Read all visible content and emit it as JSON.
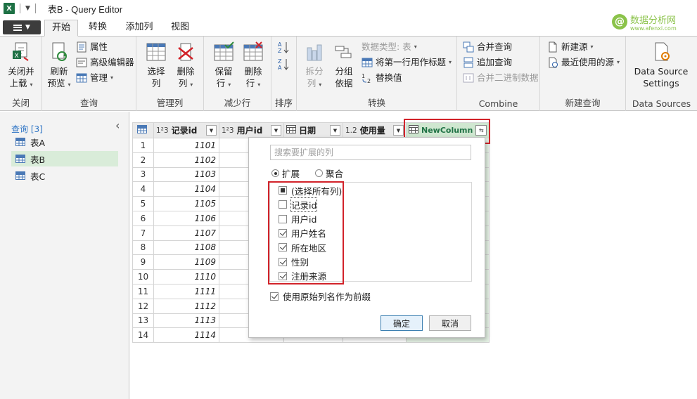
{
  "window": {
    "app_icon": "X",
    "title": "表B - Query Editor"
  },
  "tabs": [
    {
      "label": "开始",
      "active": true
    },
    {
      "label": "转换",
      "active": false
    },
    {
      "label": "添加列",
      "active": false
    },
    {
      "label": "视图",
      "active": false
    }
  ],
  "ribbon": {
    "close_group": {
      "label": "关闭",
      "close_load_line1": "关闭并",
      "close_load_line2": "上载"
    },
    "query_group": {
      "label": "查询",
      "refresh_line1": "刷新",
      "refresh_line2": "预览",
      "properties": "属性",
      "advanced_editor": "高级编辑器",
      "manage": "管理"
    },
    "manage_cols_group": {
      "label": "管理列",
      "choose_line1": "选择",
      "choose_line2": "列",
      "remove_line1": "删除",
      "remove_line2": "列"
    },
    "reduce_rows_group": {
      "label": "减少行",
      "keep_line1": "保留",
      "keep_line2": "行",
      "remove_line1": "删除",
      "remove_line2": "行"
    },
    "sort_group": {
      "label": "排序"
    },
    "transform_group": {
      "label": "转换",
      "split_line1": "拆分",
      "split_line2": "列",
      "group_line1": "分组",
      "group_line2": "依据",
      "data_type": "数据类型: 表",
      "first_row_header": "将第一行用作标题",
      "replace_values": "替换值"
    },
    "combine_group": {
      "label": "Combine",
      "merge_queries": "合并查询",
      "append_queries": "追加查询",
      "combine_binaries": "合并二进制数据"
    },
    "new_query_group": {
      "label": "新建查询",
      "new_source": "新建源",
      "recent_sources": "最近使用的源"
    },
    "data_sources_group": {
      "label": "Data Sources",
      "settings_line1": "Data Source",
      "settings_line2": "Settings"
    }
  },
  "queries_pane": {
    "header": "查询 [3]",
    "items": [
      {
        "label": "表A",
        "selected": false
      },
      {
        "label": "表B",
        "selected": true
      },
      {
        "label": "表C",
        "selected": false
      }
    ]
  },
  "grid": {
    "columns": [
      {
        "type": "1²3",
        "name": "记录id"
      },
      {
        "type": "1²3",
        "name": "用户id"
      },
      {
        "type": "date-icon",
        "name": "日期"
      },
      {
        "type": "1.2",
        "name": "使用量"
      },
      {
        "type": "table-icon",
        "name": "NewColumn"
      }
    ],
    "rows": [
      {
        "n": "1",
        "id": "1101"
      },
      {
        "n": "2",
        "id": "1102"
      },
      {
        "n": "3",
        "id": "1103"
      },
      {
        "n": "4",
        "id": "1104"
      },
      {
        "n": "5",
        "id": "1105"
      },
      {
        "n": "6",
        "id": "1106"
      },
      {
        "n": "7",
        "id": "1107"
      },
      {
        "n": "8",
        "id": "1108"
      },
      {
        "n": "9",
        "id": "1109"
      },
      {
        "n": "10",
        "id": "1110"
      },
      {
        "n": "11",
        "id": "1111"
      },
      {
        "n": "12",
        "id": "1112"
      },
      {
        "n": "13",
        "id": "1113"
      },
      {
        "n": "14",
        "id": "1114"
      }
    ]
  },
  "expand_popup": {
    "search_placeholder": "搜索要扩展的列",
    "mode_expand": "扩展",
    "mode_aggregate": "聚合",
    "columns": [
      {
        "label": "(选择所有列)",
        "state": "partial"
      },
      {
        "label": "记录id",
        "state": "unchecked"
      },
      {
        "label": "用户id",
        "state": "unchecked"
      },
      {
        "label": "用户姓名",
        "state": "checked"
      },
      {
        "label": "所在地区",
        "state": "checked"
      },
      {
        "label": "性别",
        "state": "checked"
      },
      {
        "label": "注册来源",
        "state": "checked"
      }
    ],
    "use_prefix": "使用原始列名作为前缀",
    "ok": "确定",
    "cancel": "取消"
  },
  "watermark": {
    "text": "数据分析网",
    "sub": "www.afenxi.com",
    "mark": "@"
  },
  "colors": {
    "accent_green": "#217346",
    "highlight_red": "#d2232a",
    "selected_query": "#d9ecd9"
  }
}
